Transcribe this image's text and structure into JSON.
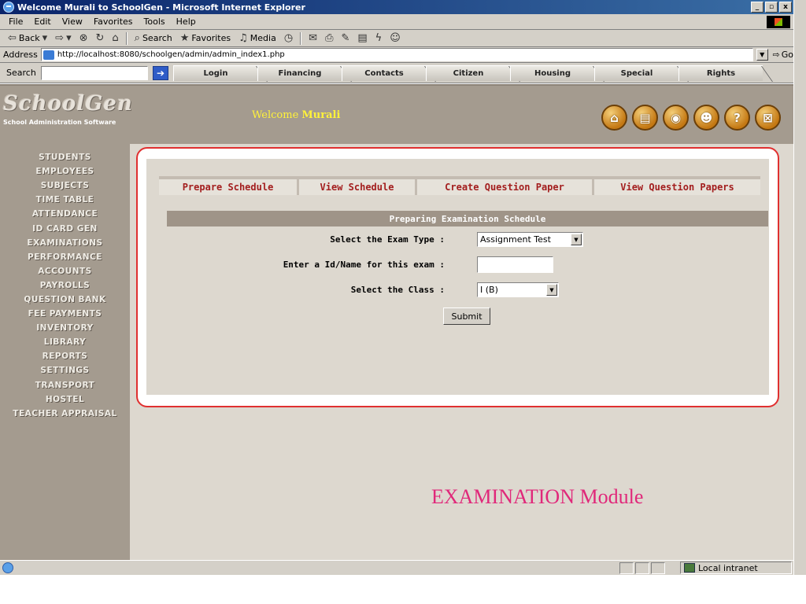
{
  "window": {
    "title": "Welcome Murali to SchoolGen - Microsoft Internet Explorer",
    "controls": [
      "_",
      "▫",
      "x"
    ]
  },
  "menu": [
    "File",
    "Edit",
    "View",
    "Favorites",
    "Tools",
    "Help"
  ],
  "toolbar": {
    "back": "Back",
    "search": "Search",
    "favorites": "Favorites",
    "media": "Media"
  },
  "address": {
    "label": "Address",
    "url": "http://localhost:8080/schoolgen/admin/admin_index1.php",
    "go": "Go"
  },
  "searchbar": {
    "label": "Search",
    "tabs": [
      "Login",
      "Financing",
      "Contacts",
      "Citizen",
      "Housing",
      "Special",
      "Rights"
    ]
  },
  "header": {
    "logo": "SchoolGen",
    "logo_sub": "School Administration Software",
    "welcome_prefix": "Welcome ",
    "user": "Murali",
    "icons": [
      {
        "name": "home-icon",
        "glyph": "⌂"
      },
      {
        "name": "book-icon",
        "glyph": "▤"
      },
      {
        "name": "globe-icon",
        "glyph": "◉"
      },
      {
        "name": "user-icon",
        "glyph": "☻"
      },
      {
        "name": "help-icon",
        "glyph": "?"
      },
      {
        "name": "close-icon",
        "glyph": "⊠"
      }
    ]
  },
  "sidebar": {
    "items": [
      "STUDENTS",
      "EMPLOYEES",
      "SUBJECTS",
      "TIME TABLE",
      "ATTENDANCE",
      "ID CARD GEN",
      "EXAMINATIONS",
      "PERFORMANCE",
      "ACCOUNTS",
      "PAYROLLS",
      "QUESTION BANK",
      "FEE PAYMENTS",
      "INVENTORY",
      "LIBRARY",
      "REPORTS",
      "SETTINGS",
      "TRANSPORT",
      "HOSTEL",
      "TEACHER APPRAISAL"
    ]
  },
  "subtabs": [
    "Prepare Schedule",
    "View Schedule",
    "Create Question Paper",
    "View Question Papers"
  ],
  "form": {
    "header": "Preparing Examination Schedule",
    "exam_type_label": "Select the Exam Type :",
    "exam_type_value": "Assignment Test",
    "exam_id_label": "Enter a Id/Name for this exam :",
    "exam_id_value": "",
    "class_label": "Select the Class :",
    "class_value": "I (B)",
    "submit": "Submit"
  },
  "module_title": "EXAMINATION Module",
  "status": {
    "zone": "Local intranet"
  }
}
